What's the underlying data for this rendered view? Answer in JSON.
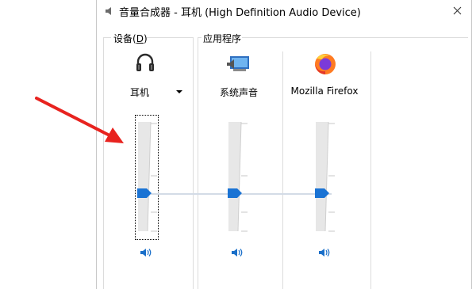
{
  "window": {
    "title": "音量合成器 - 耳机 (High Definition Audio Device)",
    "close_glyph": "✕"
  },
  "sections": {
    "device_label": "设备(D)",
    "device_label_prefix": "设备(",
    "device_label_key": "D",
    "device_label_suffix": ")",
    "apps_label": "应用程序"
  },
  "channels": [
    {
      "name": "耳机",
      "icon": "headphones-icon",
      "volume": 0.35,
      "has_dropdown": true
    },
    {
      "name": "系统声音",
      "icon": "system-sounds-icon",
      "volume": 0.35
    },
    {
      "name": "Mozilla Firefox",
      "icon": "firefox-icon",
      "volume": 0.35
    }
  ],
  "colors": {
    "thumb": "#1a73d4",
    "arrow": "#e8231f",
    "speaker": "#1a6fc9"
  }
}
